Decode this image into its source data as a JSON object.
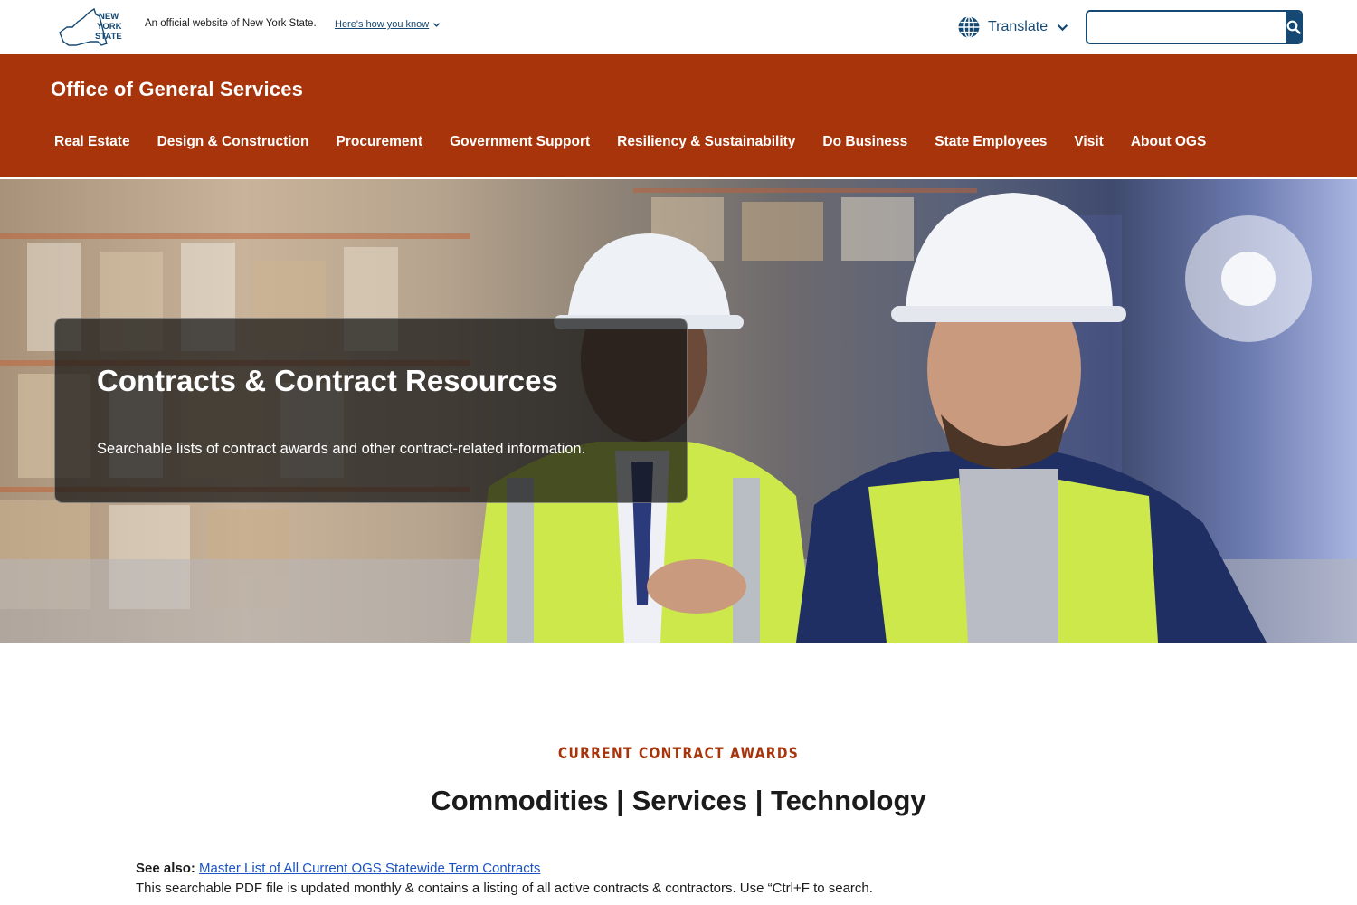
{
  "universal_header": {
    "logo_text": "NEW YORK STATE",
    "official_text": "An official website of New York State.",
    "how_you_know": "Here's how you know",
    "translate_label": "Translate",
    "search_placeholder": ""
  },
  "agency": {
    "title": "Office of General Services",
    "nav": [
      {
        "label": "Real Estate"
      },
      {
        "label": "Design & Construction"
      },
      {
        "label": "Procurement"
      },
      {
        "label": "Government Support"
      },
      {
        "label": "Resiliency & Sustainability"
      },
      {
        "label": "Do Business"
      },
      {
        "label": "State Employees"
      },
      {
        "label": "Visit"
      },
      {
        "label": "About OGS"
      }
    ]
  },
  "hero": {
    "title": "Contracts & Contract Resources",
    "subtitle": "Searchable lists of contract awards and other contract-related information."
  },
  "content": {
    "eyebrow": "CURRENT CONTRACT AWARDS",
    "section_title": "Commodities | Services | Technology",
    "see_also_label": "See also:",
    "see_also_link": "Master List of All Current OGS Statewide Term Contracts",
    "description": "This searchable PDF file is updated monthly & contains a listing of all active contracts & contractors. Use “Ctrl+F to search."
  },
  "colors": {
    "brand_orange": "#a7340b",
    "nys_blue": "#154973",
    "link_blue": "#1a53c6"
  },
  "icons": [
    "nys-logo-icon",
    "chevron-down-icon",
    "globe-icon",
    "search-icon"
  ]
}
